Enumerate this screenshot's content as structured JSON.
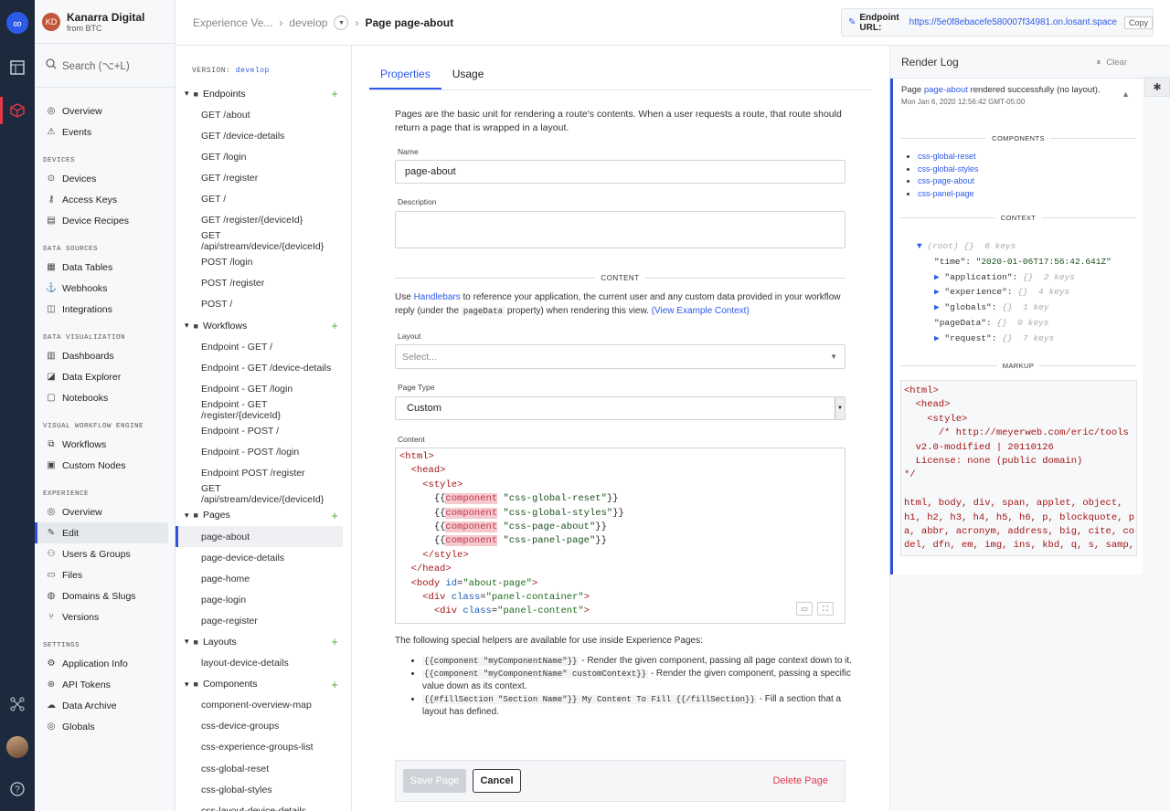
{
  "org": {
    "initials": "KD",
    "name": "Kanarra Digital",
    "sub": "from BTC"
  },
  "search": {
    "placeholder": "Search (⌥+L)"
  },
  "nav": {
    "top": [
      {
        "label": "Overview",
        "icon": "overview-icon"
      },
      {
        "label": "Events",
        "icon": "events-icon"
      }
    ],
    "sections": [
      {
        "title": "DEVICES",
        "items": [
          {
            "label": "Devices"
          },
          {
            "label": "Access Keys"
          },
          {
            "label": "Device Recipes"
          }
        ]
      },
      {
        "title": "DATA SOURCES",
        "items": [
          {
            "label": "Data Tables"
          },
          {
            "label": "Webhooks"
          },
          {
            "label": "Integrations"
          }
        ]
      },
      {
        "title": "DATA VISUALIZATION",
        "items": [
          {
            "label": "Dashboards"
          },
          {
            "label": "Data Explorer"
          },
          {
            "label": "Notebooks"
          }
        ]
      },
      {
        "title": "VISUAL WORKFLOW ENGINE",
        "items": [
          {
            "label": "Workflows"
          },
          {
            "label": "Custom Nodes"
          }
        ]
      },
      {
        "title": "EXPERIENCE",
        "items": [
          {
            "label": "Overview"
          },
          {
            "label": "Edit"
          },
          {
            "label": "Users & Groups"
          },
          {
            "label": "Files"
          },
          {
            "label": "Domains & Slugs"
          },
          {
            "label": "Versions"
          }
        ]
      },
      {
        "title": "SETTINGS",
        "items": [
          {
            "label": "Application Info"
          },
          {
            "label": "API Tokens"
          },
          {
            "label": "Data Archive"
          },
          {
            "label": "Globals"
          }
        ]
      }
    ]
  },
  "breadcrumb": {
    "root": "Experience Ve...",
    "branch": "develop",
    "page": "Page page-about"
  },
  "endpoint": {
    "label": "Endpoint URL:",
    "url": "https://5e0f8ebacefe580007f34981.on.losant.space",
    "copy": "Copy"
  },
  "tree": {
    "version_label": "VERSION:",
    "version": "develop",
    "groups": [
      {
        "title": "Endpoints",
        "items": [
          "GET /about",
          "GET /device-details",
          "GET /login",
          "GET /register",
          "GET /",
          "GET /register/{deviceId}",
          "GET /api/stream/device/{deviceId}",
          "POST /login",
          "POST /register",
          "POST /"
        ]
      },
      {
        "title": "Workflows",
        "items": [
          "Endpoint - GET /",
          "Endpoint - GET /device-details",
          "Endpoint - GET /login",
          "Endpoint - GET /register/{deviceId}",
          "Endpoint - POST /",
          "Endpoint - POST /login",
          "Endpoint POST /register",
          "GET /api/stream/device/{deviceId}"
        ]
      },
      {
        "title": "Pages",
        "items": [
          "page-about",
          "page-device-details",
          "page-home",
          "page-login",
          "page-register"
        ]
      },
      {
        "title": "Layouts",
        "items": [
          "layout-device-details"
        ]
      },
      {
        "title": "Components",
        "items": [
          "component-overview-map",
          "css-device-groups",
          "css-experience-groups-list",
          "css-global-reset",
          "css-global-styles",
          "css-layout-device-details"
        ]
      }
    ]
  },
  "tabs": [
    {
      "label": "Properties"
    },
    {
      "label": "Usage"
    }
  ],
  "form": {
    "intro": "Pages are the basic unit for rendering a route's contents. When a user requests a route, that route should return a page that is wrapped in a layout.",
    "name_label": "Name",
    "name_value": "page-about",
    "desc_label": "Description",
    "desc_value": "",
    "content_divider": "CONTENT",
    "use_pre": "Use ",
    "handlebars": "Handlebars",
    "use_mid": " to reference your application, the current user and any custom data provided in your workflow reply (under the ",
    "pagedata": "pageData",
    "use_post": " property) when rendering this view. ",
    "example_ctx": "(View Example Context)",
    "layout_label": "Layout",
    "layout_placeholder": "Select...",
    "type_label": "Page Type",
    "type_value": "Custom",
    "content_label": "Content"
  },
  "editor_lines": [
    [
      [
        "tg",
        "<html>"
      ]
    ],
    [
      [
        "sp",
        "  "
      ],
      [
        "tg",
        "<head>"
      ]
    ],
    [
      [
        "sp",
        "    "
      ],
      [
        "tg",
        "<style>"
      ]
    ],
    [
      [
        "sp",
        "      "
      ],
      [
        "p",
        "{{"
      ],
      [
        "kw",
        "component"
      ],
      [
        "p",
        " "
      ],
      [
        "str",
        "\"css-global-reset\""
      ],
      [
        "p",
        "}}"
      ]
    ],
    [
      [
        "sp",
        "      "
      ],
      [
        "p",
        "{{"
      ],
      [
        "kw",
        "component"
      ],
      [
        "p",
        " "
      ],
      [
        "str",
        "\"css-global-styles\""
      ],
      [
        "p",
        "}}"
      ]
    ],
    [
      [
        "sp",
        "      "
      ],
      [
        "p",
        "{{"
      ],
      [
        "kw",
        "component"
      ],
      [
        "p",
        " "
      ],
      [
        "str",
        "\"css-page-about\""
      ],
      [
        "p",
        "}}"
      ]
    ],
    [
      [
        "sp",
        "      "
      ],
      [
        "p",
        "{{"
      ],
      [
        "kw",
        "component"
      ],
      [
        "p",
        " "
      ],
      [
        "str",
        "\"css-panel-page\""
      ],
      [
        "p",
        "}}"
      ]
    ],
    [
      [
        "sp",
        "    "
      ],
      [
        "tg",
        "</style>"
      ]
    ],
    [
      [
        "sp",
        "  "
      ],
      [
        "tg",
        "</head>"
      ]
    ],
    [
      [
        "sp",
        "  "
      ],
      [
        "tg",
        "<body "
      ],
      [
        "at",
        "id"
      ],
      [
        "p",
        "="
      ],
      [
        "sv",
        "\"about-page\""
      ],
      [
        "tg",
        ">"
      ]
    ],
    [
      [
        "sp",
        "    "
      ],
      [
        "tg",
        "<div "
      ],
      [
        "at",
        "class"
      ],
      [
        "p",
        "="
      ],
      [
        "sv",
        "\"panel-container\""
      ],
      [
        "tg",
        ">"
      ]
    ],
    [
      [
        "sp",
        "      "
      ],
      [
        "tg",
        "<div "
      ],
      [
        "at",
        "class"
      ],
      [
        "p",
        "="
      ],
      [
        "sv",
        "\"panel-content\""
      ],
      [
        "tg",
        ">"
      ]
    ]
  ],
  "helpers": {
    "intro": "The following special helpers are available for use inside Experience Pages:",
    "items": [
      {
        "code": "{{component \"myComponentName\"}}",
        "text": " - Render the given component, passing all page context down to it."
      },
      {
        "code": "{{component \"myComponentName\" customContext}}",
        "text": " - Render the given component, passing a specific value down as its context."
      },
      {
        "code": "{{#fillSection \"Section Name\"}} My Content To Fill {{/fillSection}}",
        "text": " - Fill a section that a layout has defined."
      }
    ]
  },
  "buttons": {
    "save": "Save Page",
    "cancel": "Cancel",
    "delete": "Delete Page"
  },
  "render_log": {
    "title": "Render Log",
    "clear": "Clear",
    "msg_pre": "Page ",
    "msg_link": "page-about",
    "msg_post": " rendered successfully (no layout).",
    "time": "Mon Jan 6, 2020 12:56:42 GMT-05:00",
    "components_title": "COMPONENTS",
    "components": [
      "css-global-reset",
      "css-global-styles",
      "css-page-about",
      "css-panel-page"
    ],
    "context_title": "CONTEXT",
    "markup_title": "MARKUP"
  },
  "context_lines": [
    {
      "indent": 0,
      "arrow": "▼ ",
      "key": "(root)",
      "type": " {}  6 keys",
      "muted_key": true
    },
    {
      "indent": 1,
      "arrow": "",
      "key": "\"time\"",
      "sep": ": ",
      "val": "\"2020-01-06T17:56:42.641Z\""
    },
    {
      "indent": 1,
      "arrow": "▶ ",
      "key": "\"application\"",
      "sep": ": ",
      "type": "{}  2 keys"
    },
    {
      "indent": 1,
      "arrow": "▶ ",
      "key": "\"experience\"",
      "sep": ": ",
      "type": "{}  4 keys"
    },
    {
      "indent": 1,
      "arrow": "▶ ",
      "key": "\"globals\"",
      "sep": ": ",
      "type": "{}  1 key"
    },
    {
      "indent": 1,
      "arrow": "",
      "key": "\"pageData\"",
      "sep": ": ",
      "type": "{}  0 keys"
    },
    {
      "indent": 1,
      "arrow": "▶ ",
      "key": "\"request\"",
      "sep": ": ",
      "type": "{}  7 keys"
    }
  ],
  "markup_lines": [
    "<html>",
    "  <head>",
    "    <style>",
    "      /* http://meyerweb.com/eric/tools",
    "  v2.0-modified | 20110126",
    "  License: none (public domain)",
    "*/",
    "",
    "html, body, div, span, applet, object,",
    "h1, h2, h3, h4, h5, h6, p, blockquote, p",
    "a, abbr, acronym, address, big, cite, co",
    "del, dfn, em, img, ins, kbd, q, s, samp,"
  ]
}
